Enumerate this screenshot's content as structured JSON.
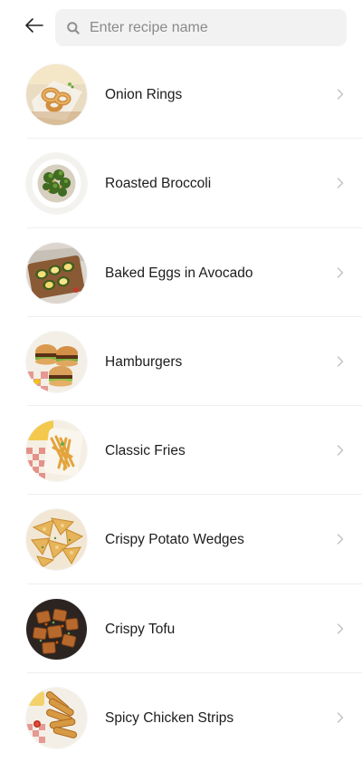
{
  "header": {
    "back_icon": "arrow-left-icon",
    "search": {
      "icon": "search-icon",
      "placeholder": "Enter recipe name",
      "value": ""
    }
  },
  "recipes": [
    {
      "name": "Onion Rings",
      "thumb": "onion-rings"
    },
    {
      "name": "Roasted Broccoli",
      "thumb": "roasted-broccoli"
    },
    {
      "name": "Baked Eggs in Avocado",
      "thumb": "baked-eggs-avocado"
    },
    {
      "name": "Hamburgers",
      "thumb": "hamburgers"
    },
    {
      "name": "Classic Fries",
      "thumb": "classic-fries"
    },
    {
      "name": "Crispy Potato Wedges",
      "thumb": "potato-wedges"
    },
    {
      "name": "Crispy Tofu",
      "thumb": "crispy-tofu"
    },
    {
      "name": "Spicy Chicken Strips",
      "thumb": "chicken-strips"
    }
  ],
  "colors": {
    "search_bg": "#f2f2f2",
    "divider": "#eeeeee",
    "chevron": "#c4c4c4",
    "text": "#1c1c1c",
    "placeholder": "#8a8a8a"
  }
}
